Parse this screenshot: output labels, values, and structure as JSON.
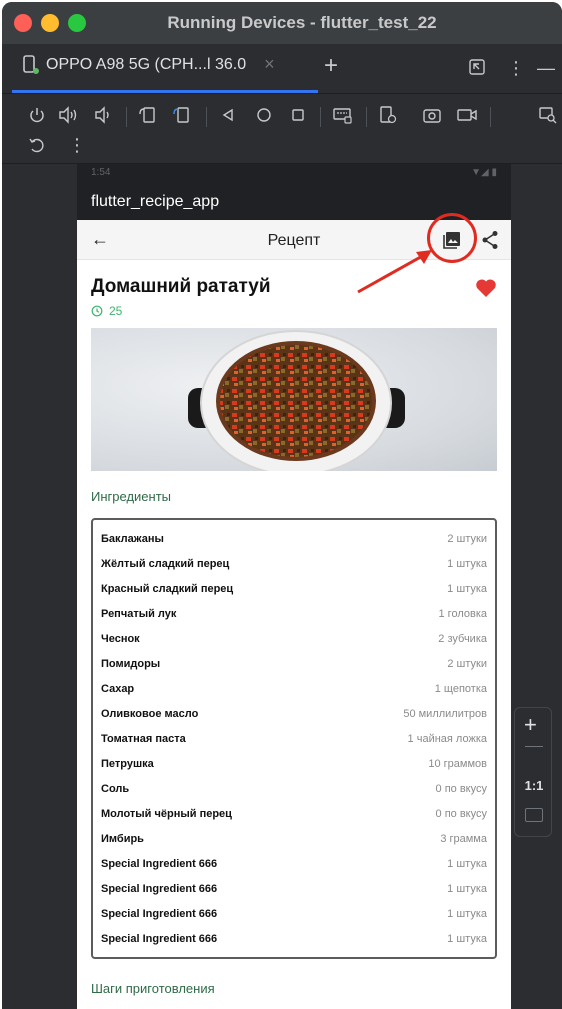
{
  "window": {
    "title": "Running Devices - flutter_test_22"
  },
  "tab": {
    "label": "OPPO A98 5G (CPH...l 36.0",
    "close": "×",
    "add": "+"
  },
  "toolbar": {
    "icons": [
      "power-icon",
      "volume-up-icon",
      "volume-down-icon",
      "rotate-left-icon",
      "rotate-right-icon",
      "back-icon",
      "home-icon",
      "overview-icon",
      "keyboard-icon",
      "device-settings-icon",
      "screenshot-icon",
      "screen-record-icon",
      "layout-inspector-icon",
      "reset-icon",
      "more-icon"
    ]
  },
  "phone": {
    "status": {
      "time": "1:54",
      "signals": "▼◢ ▮"
    },
    "app_name": "flutter_recipe_app",
    "appbar": {
      "back": "←",
      "title": "Рецепт"
    },
    "recipe": {
      "title": "Домашний рататуй",
      "time": "25",
      "favorite": true
    },
    "ingredients_label": "Ингредиенты",
    "ingredients": [
      {
        "name": "Баклажаны",
        "qty": "2 штуки"
      },
      {
        "name": "Жёлтый сладкий перец",
        "qty": "1 штука"
      },
      {
        "name": "Красный сладкий перец",
        "qty": "1 штука"
      },
      {
        "name": "Репчатый лук",
        "qty": "1 головка"
      },
      {
        "name": "Чеснок",
        "qty": "2 зубчика"
      },
      {
        "name": "Помидоры",
        "qty": "2 штуки"
      },
      {
        "name": "Сахар",
        "qty": "1 щепотка"
      },
      {
        "name": "Оливковое масло",
        "qty": "50 миллилитров"
      },
      {
        "name": "Томатная паста",
        "qty": "1 чайная ложка"
      },
      {
        "name": "Петрушка",
        "qty": "10 граммов"
      },
      {
        "name": "Соль",
        "qty": "0 по вкусу"
      },
      {
        "name": "Молотый чёрный перец",
        "qty": "0 по вкусу"
      },
      {
        "name": "Имбирь",
        "qty": "3 грамма"
      },
      {
        "name": "Special Ingredient 666",
        "qty": "1 штука"
      },
      {
        "name": "Special Ingredient 666",
        "qty": "1 штука"
      },
      {
        "name": "Special Ingredient 666",
        "qty": "1 штука"
      },
      {
        "name": "Special Ingredient 666",
        "qty": "1 штука"
      }
    ],
    "steps_label": "Шаги приготовления"
  },
  "zoom": {
    "plus": "+",
    "ratio": "1:1"
  },
  "colors": {
    "accent": "#3574f0",
    "heart": "#e53935",
    "time_green": "#3bb56c",
    "section_green": "#2f6b47",
    "annotation": "#e02b20"
  }
}
